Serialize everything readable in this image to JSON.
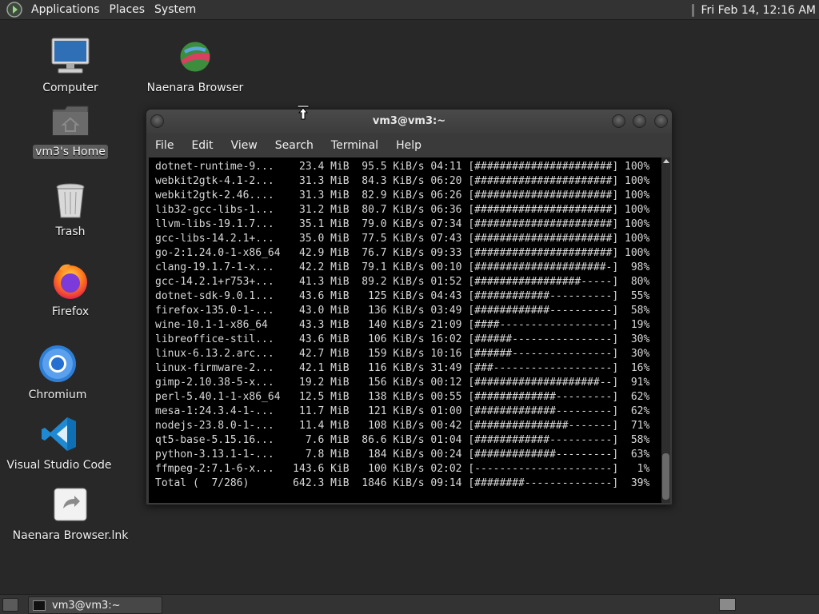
{
  "top_panel": {
    "menus": [
      "Applications",
      "Places",
      "System"
    ],
    "clock": "Fri Feb 14, 12:16 AM"
  },
  "desktop_icons": {
    "computer": "Computer",
    "naenara_browser": "Naenara Browser",
    "home": "vm3's Home",
    "trash": "Trash",
    "firefox": "Firefox",
    "chromium": "Chromium",
    "vscode": "Visual Studio Code",
    "naenara_lnk": "Naenara Browser.lnk"
  },
  "terminal": {
    "title": "vm3@vm3:~",
    "menu": [
      "File",
      "Edit",
      "View",
      "Search",
      "Terminal",
      "Help"
    ],
    "lines": [
      "dotnet-runtime-9...    23.4 MiB  95.5 KiB/s 04:11 [######################] 100%",
      "webkit2gtk-4.1-2...    31.3 MiB  84.3 KiB/s 06:20 [######################] 100%",
      "webkit2gtk-2.46....    31.3 MiB  82.9 KiB/s 06:26 [######################] 100%",
      "lib32-gcc-libs-1...    31.2 MiB  80.7 KiB/s 06:36 [######################] 100%",
      "llvm-libs-19.1.7...    35.1 MiB  79.0 KiB/s 07:34 [######################] 100%",
      "gcc-libs-14.2.1+...    35.0 MiB  77.5 KiB/s 07:43 [######################] 100%",
      "go-2:1.24.0-1-x86_64   42.9 MiB  76.7 KiB/s 09:33 [######################] 100%",
      "clang-19.1.7-1-x...    42.2 MiB  79.1 KiB/s 00:10 [#####################-]  98%",
      "gcc-14.2.1+r753+...    41.3 MiB  89.2 KiB/s 01:52 [#################-----]  80%",
      "dotnet-sdk-9.0.1...    43.6 MiB   125 KiB/s 04:43 [############----------]  55%",
      "firefox-135.0-1-...    43.0 MiB   136 KiB/s 03:49 [############----------]  58%",
      "wine-10.1-1-x86_64     43.3 MiB   140 KiB/s 21:09 [####------------------]  19%",
      "libreoffice-stil...    43.6 MiB   106 KiB/s 16:02 [######----------------]  30%",
      "linux-6.13.2.arc...    42.7 MiB   159 KiB/s 10:16 [######----------------]  30%",
      "linux-firmware-2...    42.1 MiB   116 KiB/s 31:49 [###-------------------]  16%",
      "gimp-2.10.38-5-x...    19.2 MiB   156 KiB/s 00:12 [####################--]  91%",
      "perl-5.40.1-1-x86_64   12.5 MiB   138 KiB/s 00:55 [#############---------]  62%",
      "mesa-1:24.3.4-1-...    11.7 MiB   121 KiB/s 01:00 [#############---------]  62%",
      "nodejs-23.8.0-1-...    11.4 MiB   108 KiB/s 00:42 [###############-------]  71%",
      "qt5-base-5.15.16...     7.6 MiB  86.6 KiB/s 01:04 [############----------]  58%",
      "python-3.13.1-1-...     7.8 MiB   184 KiB/s 00:24 [#############---------]  63%",
      "ffmpeg-2:7.1-6-x...   143.6 KiB   100 KiB/s 02:02 [----------------------]   1%",
      "Total (  7/286)       642.3 MiB  1846 KiB/s 09:14 [########--------------]  39%"
    ]
  },
  "taskbar": {
    "window_label": "vm3@vm3:~"
  }
}
